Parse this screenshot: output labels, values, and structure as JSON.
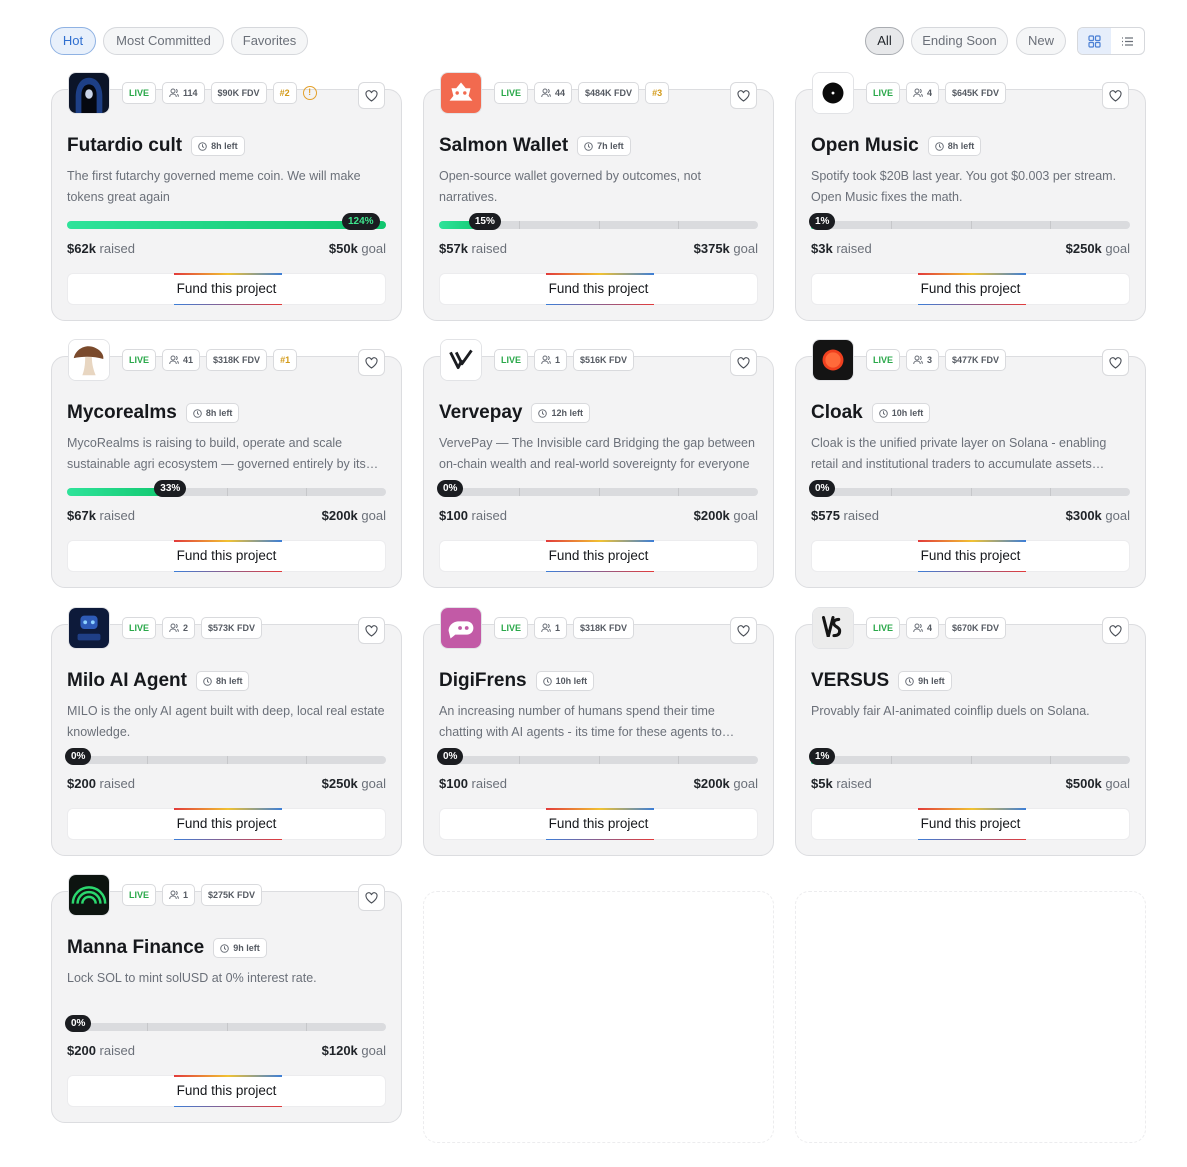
{
  "filters_left": [
    "Hot",
    "Most Committed",
    "Favorites"
  ],
  "filters_right": [
    "All",
    "Ending Soon",
    "New"
  ],
  "fund_label": "Fund this project",
  "raised_suffix": "raised",
  "goal_suffix": "goal",
  "live_label": "LIVE",
  "projects": [
    {
      "name": "Futardio cult",
      "time_left": "8h left",
      "backers": "114",
      "fdv": "$90K FDV",
      "rank": "#2",
      "warning": true,
      "description": "The first futarchy governed meme coin. We will make tokens great again",
      "progress_pct": 124,
      "progress_label": "124%",
      "raised": "$62k",
      "goal": "$50k",
      "logo": "hooded-figure-logo"
    },
    {
      "name": "Salmon Wallet",
      "time_left": "7h left",
      "backers": "44",
      "fdv": "$484K FDV",
      "rank": "#3",
      "warning": false,
      "description": "Open-source wallet governed by outcomes, not narratives.",
      "progress_pct": 15,
      "progress_label": "15%",
      "raised": "$57k",
      "goal": "$375k",
      "logo": "salmon-logo"
    },
    {
      "name": "Open Music",
      "time_left": "8h left",
      "backers": "4",
      "fdv": "$645K FDV",
      "rank": null,
      "warning": false,
      "description": "Spotify took $20B last year. You got $0.003 per stream. Open Music fixes the math.",
      "progress_pct": 1,
      "progress_label": "1%",
      "raised": "$3k",
      "goal": "$250k",
      "logo": "vinyl-logo"
    },
    {
      "name": "Mycorealms",
      "time_left": "8h left",
      "backers": "41",
      "fdv": "$318K FDV",
      "rank": "#1",
      "warning": false,
      "description": "MycoRealms is raising to build, operate and scale sustainable agri ecosystem — governed entirely by its token holders through futarchy",
      "progress_pct": 33,
      "progress_label": "33%",
      "raised": "$67k",
      "goal": "$200k",
      "logo": "mushroom-logo"
    },
    {
      "name": "Vervepay",
      "time_left": "12h left",
      "backers": "1",
      "fdv": "$516K FDV",
      "rank": null,
      "warning": false,
      "description": "VervePay — The Invisible card Bridging the gap between on-chain wealth and real-world sovereignty for everyone",
      "progress_pct": 0,
      "progress_label": "0%",
      "raised": "$100",
      "goal": "$200k",
      "logo": "vervepay-logo"
    },
    {
      "name": "Cloak",
      "time_left": "10h left",
      "backers": "3",
      "fdv": "$477K FDV",
      "rank": null,
      "warning": false,
      "description": "Cloak is the unified private layer on Solana - enabling retail and institutional traders to accumulate assets privately",
      "progress_pct": 0,
      "progress_label": "0%",
      "raised": "$575",
      "goal": "$300k",
      "logo": "cloak-logo"
    },
    {
      "name": "Milo AI Agent",
      "time_left": "8h left",
      "backers": "2",
      "fdv": "$573K FDV",
      "rank": null,
      "warning": false,
      "description": "MILO is the only AI agent built with deep, local real estate knowledge.",
      "progress_pct": 0,
      "progress_label": "0%",
      "raised": "$200",
      "goal": "$250k",
      "logo": "milo-logo"
    },
    {
      "name": "DigiFrens",
      "time_left": "10h left",
      "backers": "1",
      "fdv": "$318K FDV",
      "rank": null,
      "warning": false,
      "description": "An increasing number of humans spend their time chatting with AI agents - its time for these agents to become friends",
      "progress_pct": 0,
      "progress_label": "0%",
      "raised": "$100",
      "goal": "$200k",
      "logo": "digifrens-logo"
    },
    {
      "name": "VERSUS",
      "time_left": "9h left",
      "backers": "4",
      "fdv": "$670K FDV",
      "rank": null,
      "warning": false,
      "description": "Provably fair AI-animated coinflip duels on Solana.",
      "progress_pct": 1,
      "progress_label": "1%",
      "raised": "$5k",
      "goal": "$500k",
      "logo": "versus-logo"
    },
    {
      "name": "Manna Finance",
      "time_left": "9h left",
      "backers": "1",
      "fdv": "$275K FDV",
      "rank": null,
      "warning": false,
      "description": "Lock SOL to mint solUSD at 0% interest rate.",
      "progress_pct": 0,
      "progress_label": "0%",
      "raised": "$200",
      "goal": "$120k",
      "logo": "manna-logo"
    }
  ]
}
